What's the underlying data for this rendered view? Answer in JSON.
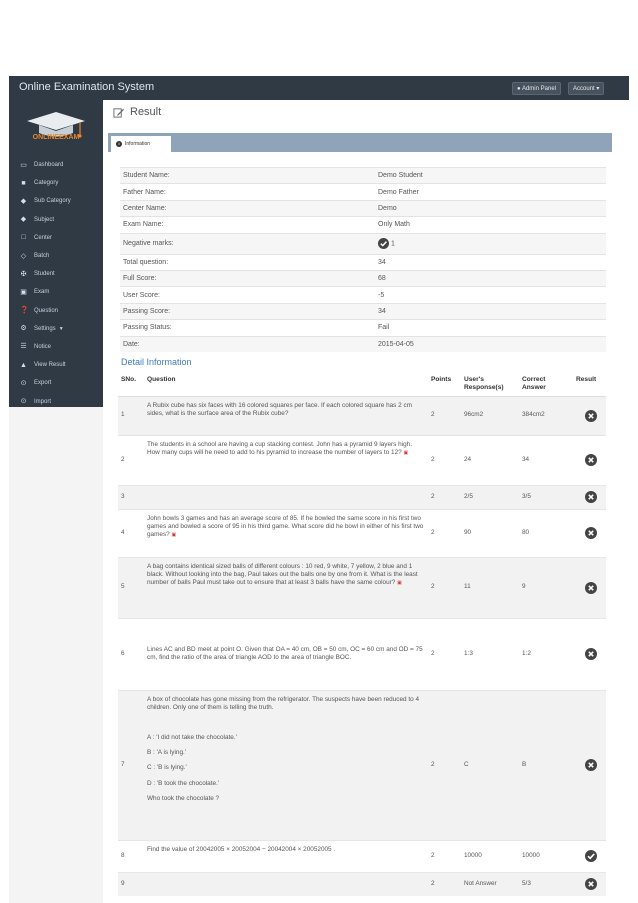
{
  "app": {
    "title": "Online Examination System",
    "admin_panel_label": "Admin Panel",
    "account_label": "Account"
  },
  "sidebar": {
    "logo_text": "ONLINEEXAM",
    "items": [
      {
        "label": "Dashboard",
        "icon": "monitor-icon"
      },
      {
        "label": "Category",
        "icon": "folder-icon"
      },
      {
        "label": "Sub Category",
        "icon": "tags-icon"
      },
      {
        "label": "Subject",
        "icon": "tag-icon"
      },
      {
        "label": "Center",
        "icon": "building-icon"
      },
      {
        "label": "Batch",
        "icon": "diamond-icon"
      },
      {
        "label": "Student",
        "icon": "person-icon"
      },
      {
        "label": "Exam",
        "icon": "book-icon"
      },
      {
        "label": "Question",
        "icon": "question-icon"
      },
      {
        "label": "Settings",
        "icon": "gears-icon"
      },
      {
        "label": "Notice",
        "icon": "list-icon"
      },
      {
        "label": "View Result",
        "icon": "trophy-icon"
      },
      {
        "label": "Export",
        "icon": "export-icon"
      },
      {
        "label": "Import",
        "icon": "import-icon"
      }
    ]
  },
  "page": {
    "title": "Result",
    "tab_label": "Information",
    "detail_heading": "Detail Information"
  },
  "info": {
    "rows": [
      {
        "label": "Student Name:",
        "value": "Demo Student"
      },
      {
        "label": "Father Name:",
        "value": "Demo Father"
      },
      {
        "label": "Center Name:",
        "value": "Demo"
      },
      {
        "label": "Exam Name:",
        "value": "Only Math"
      },
      {
        "label": "Negative marks:",
        "value": "1"
      },
      {
        "label": "Total question:",
        "value": "34"
      },
      {
        "label": "Full Score:",
        "value": "68"
      },
      {
        "label": "User Score:",
        "value": "-5"
      },
      {
        "label": "Passing Score:",
        "value": "34"
      },
      {
        "label": "Passing Status:",
        "value": "Fail"
      },
      {
        "label": "Date:",
        "value": "2015-04-05"
      }
    ]
  },
  "detail": {
    "headers": {
      "sno": "SNo.",
      "question": "Question",
      "points": "Points",
      "response_1": "User's",
      "response_2": "Response(s)",
      "correct_1": "Correct",
      "correct_2": "Answer",
      "result": "Result"
    },
    "rows": [
      {
        "sno": "1",
        "question": "A Rubix cube has six faces with 16 colored squares per face. If each colored square has 2 cm sides, what is the surface area of the Rubix cube?",
        "points": "2",
        "response": "96cm2",
        "correct": "384cm2",
        "result": "wrong"
      },
      {
        "sno": "2",
        "question": "The students in a school are having a cup stacking contest. John has a pyramid 9 layers high. How many cups will he need to add to his pyramid to increase the number of layers to 12?",
        "points": "2",
        "response": "24",
        "correct": "34",
        "result": "wrong"
      },
      {
        "sno": "3",
        "question": "",
        "points": "2",
        "response": "2/5",
        "correct": "3/5",
        "result": "wrong"
      },
      {
        "sno": "4",
        "question": "John bowls 3 games and has an average score of 85. If he bowled the same score in his first two games and bowled a score of 95 in his third game. What score did he bowl in either of his first two games?",
        "points": "2",
        "response": "90",
        "correct": "80",
        "result": "wrong"
      },
      {
        "sno": "5",
        "question": "A bag contains identical sized balls of different colours : 10 red, 9 white, 7 yellow, 2 blue and 1 black. Without looking into the bag, Paul takes out the balls one by one from it. What is the least number of balls Paul must take out to ensure that at least 3 balls have the same colour?",
        "points": "2",
        "response": "11",
        "correct": "9",
        "result": "wrong"
      },
      {
        "sno": "6",
        "question": "Lines AC and BD meet at point O. Given that OA = 40 cm, OB = 50 cm, OC = 60 cm and OD = 75 cm, find the ratio of the area of triangle AOD to the area of triangle BOC.",
        "points": "2",
        "response": "1:3",
        "correct": "1:2",
        "result": "wrong"
      },
      {
        "sno": "7",
        "question_intro": "A box of chocolate has gone missing from the refrigerator. The suspects have been reduced to 4 children. Only one of them is telling the truth.",
        "question_lines": [
          "A : 'I did not take the chocolate.'",
          "B : 'A is lying.'",
          "C : 'B is lying.'",
          "D : 'B took the chocolate.'",
          "Who took the chocolate ?"
        ],
        "points": "2",
        "response": "C",
        "correct": "B",
        "result": "wrong"
      },
      {
        "sno": "8",
        "question": "Find the value of 20042005 × 20052004 − 20042004 × 20052005 .",
        "points": "2",
        "response": "10000",
        "correct": "10000",
        "result": "correct"
      },
      {
        "sno": "9",
        "question": "",
        "points": "2",
        "response": "Not Answer",
        "correct": "5/3",
        "result": "wrong"
      }
    ]
  },
  "colors": {
    "nav_bg": "#2f3a45",
    "tab_bar": "#8fa3b9",
    "heading_blue": "#3c7db8",
    "logo_orange": "#e8862a",
    "result_icon": "#444444"
  }
}
